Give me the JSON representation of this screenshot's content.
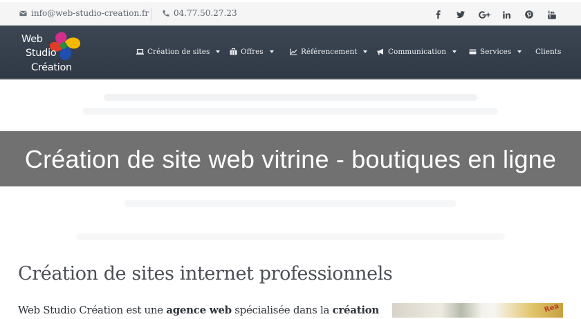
{
  "topbar": {
    "email": "info@web-studio-creation.fr",
    "phone": "04.77.50.27.23",
    "social": [
      {
        "name": "facebook-icon",
        "glyph": "f"
      },
      {
        "name": "twitter-icon",
        "glyph": "t"
      },
      {
        "name": "google-plus-icon",
        "glyph": "G+"
      },
      {
        "name": "linkedin-icon",
        "glyph": "in"
      },
      {
        "name": "pinterest-icon",
        "glyph": "p"
      },
      {
        "name": "youtube-icon",
        "glyph": "yt"
      }
    ]
  },
  "logo": {
    "line1": "Web",
    "line2": "Studio",
    "line3": "Création",
    "colors": [
      "#e23b2a",
      "#f5b800",
      "#2a8c3c",
      "#1f4fb0",
      "#d12f8c"
    ]
  },
  "nav": {
    "items": [
      {
        "label": "Création de sites",
        "icon": "laptop-icon",
        "dropdown": true
      },
      {
        "label": "Offres",
        "icon": "briefcase-icon",
        "dropdown": true
      },
      {
        "label": "Référencement",
        "icon": "line-chart-icon",
        "dropdown": true
      },
      {
        "label": "Communication",
        "icon": "bullhorn-icon",
        "dropdown": true
      },
      {
        "label": "Services",
        "icon": "card-icon",
        "dropdown": true
      },
      {
        "label": "Clients",
        "icon": "",
        "dropdown": false
      }
    ]
  },
  "banner": {
    "title": "Création de site web vitrine - boutiques en ligne"
  },
  "content": {
    "title": "Création de sites internet professionnels",
    "intro_part1": "Web Studio Création est une ",
    "intro_bold1": "agence web",
    "intro_part2": " spécialisée dans la ",
    "intro_bold2": "création"
  },
  "colors": {
    "navbar": "#343d4a",
    "banner": "#6c6c6c",
    "topbar": "#f5f5f5"
  }
}
